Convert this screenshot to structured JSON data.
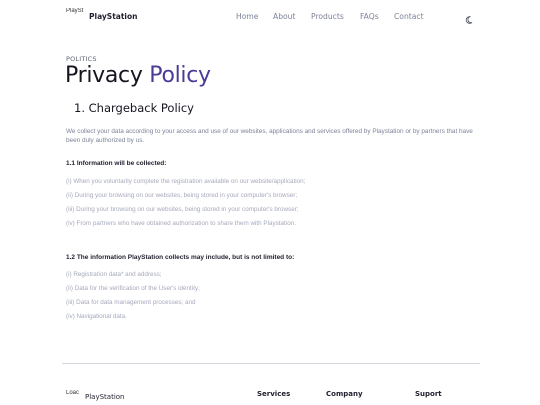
{
  "header": {
    "logo_alt": "PlaySt",
    "brand": "PlayStation",
    "nav": [
      "Home",
      "About",
      "Products",
      "FAQs",
      "Contact"
    ],
    "theme_icon": "moon-icon"
  },
  "page": {
    "eyebrow": "POLITICS",
    "title_main": "Privacy",
    "title_accent": "Policy",
    "accent_color": "#4b3b96",
    "section_title": "1. Chargeback Policy",
    "intro": "We collect your data according to your access and use of our websites, applications and services offered by Playstation or by partners that have been duly authorized by us.",
    "s1": {
      "heading": "1.1 Information will be collected:",
      "items": [
        "(i) When you voluntarily complete the registration available on our website/application;",
        "(ii) During your browsing on our websites, being stored in your computer's browser;",
        "(iii) During your browsing on our websites, being stored in your computer's browser;",
        "(iv) From partners who have obtained authorization to share them with Playstation."
      ]
    },
    "s2": {
      "heading": "1.2 The information PlayStation collects may include, but is not limited to:",
      "items": [
        "(i) Registration data* and address;",
        "(ii) Data for the verification of the User's identity;",
        "(iii) Data for data management processes; and",
        "(iv) Navigational data."
      ]
    }
  },
  "footer": {
    "logo_alt": "Loac",
    "brand": "PlayStation",
    "columns": [
      "Services",
      "Company",
      "Suport"
    ]
  }
}
